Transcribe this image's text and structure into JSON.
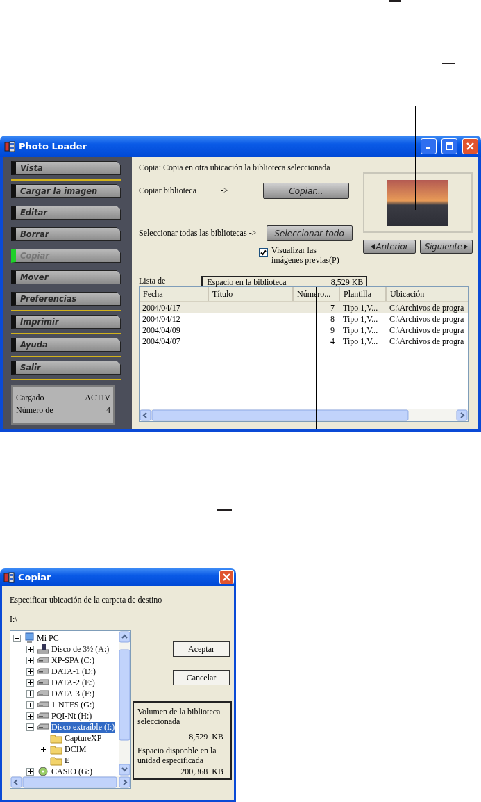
{
  "main_window": {
    "title": "Photo Loader",
    "sidebar": {
      "items": [
        {
          "label": "Vista",
          "disabled": false,
          "divider_below": true
        },
        {
          "label": "Cargar la imagen",
          "disabled": false,
          "divider_below": false
        },
        {
          "label": "Editar",
          "disabled": false,
          "divider_below": false
        },
        {
          "label": "Borrar",
          "disabled": false,
          "divider_below": false
        },
        {
          "label": "Copiar",
          "disabled": true,
          "divider_below": false
        },
        {
          "label": "Mover",
          "disabled": false,
          "divider_below": false
        },
        {
          "label": "Preferencias",
          "disabled": false,
          "divider_below": true
        },
        {
          "label": "Imprimir",
          "disabled": false,
          "divider_below": true
        },
        {
          "label": "Ayuda",
          "disabled": false,
          "divider_below": true
        },
        {
          "label": "Salir",
          "disabled": false,
          "divider_below": true
        }
      ],
      "status": [
        {
          "label": "Cargado",
          "value": "ACTIV"
        },
        {
          "label": "Número de",
          "value": "4"
        }
      ]
    },
    "description": "Copia: Copia en otra ubicación la biblioteca seleccionada",
    "copy_row": {
      "label": "Copiar biblioteca",
      "arrow": "->",
      "button": "Copiar..."
    },
    "select_row": {
      "label": "Seleccionar todas las bibliotecas",
      "arrow": "->",
      "button": "Seleccionar todo"
    },
    "preview_checkbox": {
      "label": "Visualizar las imágenes previas(P)",
      "checked": true
    },
    "nav_buttons": {
      "previous": "Anterior",
      "next": "Siguiente"
    },
    "list_label": "Lista de",
    "library_space": {
      "label": "Espacio en la biblioteca",
      "value": "8,529 KB"
    },
    "table": {
      "columns": [
        "Fecha",
        "Título",
        "Número...",
        "Plantilla",
        "Ubicación"
      ],
      "rows": [
        {
          "date": "2004/04/17",
          "number": "7",
          "template": "Tipo 1,V...",
          "location": "C:\\Archivos de progra",
          "selected": true
        },
        {
          "date": "2004/04/12",
          "number": "8",
          "template": "Tipo 1,V...",
          "location": "C:\\Archivos de progra",
          "selected": false
        },
        {
          "date": "2004/04/09",
          "number": "9",
          "template": "Tipo 1,V...",
          "location": "C:\\Archivos de progra",
          "selected": false
        },
        {
          "date": "2004/04/07",
          "number": "4",
          "template": "Tipo 1,V...",
          "location": "C:\\Archivos de progra",
          "selected": false
        }
      ]
    }
  },
  "copy_dialog": {
    "title": "Copiar",
    "instruction": "Especificar ubicación de la carpeta de destino",
    "path": "I:\\",
    "tree": [
      {
        "label": "Mi PC",
        "kind": "computer",
        "expanded": true,
        "selected": false,
        "children": [
          {
            "label": "Disco de 3½ (A:)",
            "kind": "floppy",
            "expanded": false,
            "selected": false
          },
          {
            "label": "XP-SPA (C:)",
            "kind": "drive",
            "expanded": false,
            "selected": false
          },
          {
            "label": "DATA-1 (D:)",
            "kind": "drive",
            "expanded": false,
            "selected": false
          },
          {
            "label": "DATA-2 (E:)",
            "kind": "drive",
            "expanded": false,
            "selected": false
          },
          {
            "label": "DATA-3 (F:)",
            "kind": "drive",
            "expanded": false,
            "selected": false
          },
          {
            "label": "1-NTFS (G:)",
            "kind": "drive",
            "expanded": false,
            "selected": false
          },
          {
            "label": "PQI-Nt (H:)",
            "kind": "drive",
            "expanded": false,
            "selected": false
          },
          {
            "label": "Disco extraíble (I:)",
            "kind": "drive",
            "expanded": true,
            "selected": true,
            "children": [
              {
                "label": "CaptureXP",
                "kind": "folder",
                "selected": false
              },
              {
                "label": "DCIM",
                "kind": "folder",
                "expanded": false,
                "selected": false
              },
              {
                "label": "E",
                "kind": "folder",
                "selected": false
              }
            ]
          },
          {
            "label": "CASIO (G:)",
            "kind": "cd",
            "expanded": false,
            "selected": false
          }
        ]
      }
    ],
    "buttons": [
      "Aceptar",
      "Cancelar"
    ],
    "info": {
      "volume_label": "Volumen de la biblioteca seleccionada",
      "volume_value": "8,529  KB",
      "free_label": "Espacio disponble en la unidad especificada",
      "free_value": "200,368  KB"
    }
  }
}
